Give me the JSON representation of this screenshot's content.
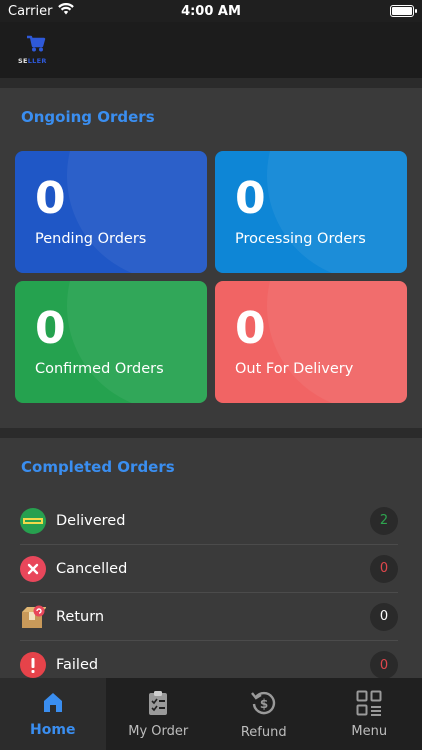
{
  "status_bar": {
    "carrier": "Carrier",
    "time": "4:00 AM"
  },
  "header": {
    "logo_prefix": "SE",
    "logo_suffix": "LLER"
  },
  "ongoing": {
    "title": "Ongoing Orders",
    "cards": [
      {
        "count": "0",
        "label": "Pending Orders",
        "color": "#1f57c6"
      },
      {
        "count": "0",
        "label": "Processing Orders",
        "color": "#0e86d6"
      },
      {
        "count": "0",
        "label": "Confirmed Orders",
        "color": "#25a24f"
      },
      {
        "count": "0",
        "label": "Out For Delivery",
        "color": "#f16464"
      }
    ]
  },
  "completed": {
    "title": "Completed Orders",
    "items": [
      {
        "label": "Delivered",
        "count": "2",
        "count_color": "#2ea44f",
        "icon": "delivered-badge-icon"
      },
      {
        "label": "Cancelled",
        "count": "0",
        "count_color": "#e0474c",
        "icon": "cancel-x-icon"
      },
      {
        "label": "Return",
        "count": "0",
        "count_color": "#ffffff",
        "icon": "return-box-icon"
      },
      {
        "label": "Failed",
        "count": "0",
        "count_color": "#e0474c",
        "icon": "warning-icon"
      }
    ]
  },
  "nav": {
    "items": [
      {
        "label": "Home",
        "icon": "home-icon",
        "active": true
      },
      {
        "label": "My Order",
        "icon": "clipboard-icon",
        "active": false
      },
      {
        "label": "Refund",
        "icon": "refund-icon",
        "active": false
      },
      {
        "label": "Menu",
        "icon": "grid-menu-icon",
        "active": false
      }
    ],
    "accent": "#3a8ef0"
  }
}
